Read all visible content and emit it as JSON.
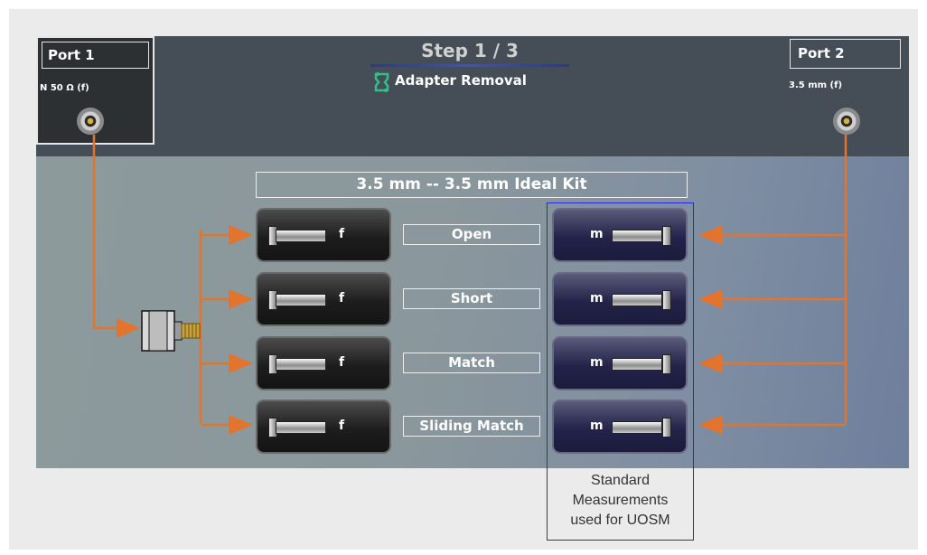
{
  "header": {
    "step_title": "Step 1 / 3",
    "subtitle": "Adapter Removal",
    "subtitle_icon": "adapter-icon"
  },
  "port1": {
    "title": "Port 1",
    "connector": "N 50 Ω (f)"
  },
  "port2": {
    "title": "Port 2",
    "connector": "3.5 mm (f)"
  },
  "kit_title": "3.5 mm  -- 3.5 mm Ideal Kit",
  "standards": [
    {
      "label": "Open",
      "left_sex": "f",
      "right_sex": "m"
    },
    {
      "label": "Short",
      "left_sex": "f",
      "right_sex": "m"
    },
    {
      "label": "Match",
      "left_sex": "f",
      "right_sex": "m"
    },
    {
      "label": "Sliding Match",
      "left_sex": "f",
      "right_sex": "m"
    }
  ],
  "annotation": {
    "line1": "Standard",
    "line2": "Measurements",
    "line3": "used for UOSM"
  },
  "colors": {
    "accent": "#e2742e",
    "highlight_box": "#2626e6",
    "header_bg": "#454d56"
  }
}
